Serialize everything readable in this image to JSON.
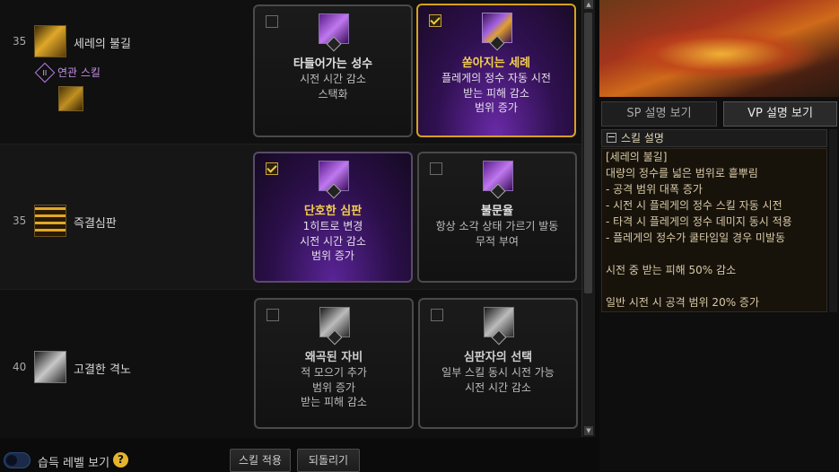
{
  "rows": [
    {
      "level": "35",
      "name": "세레의 불길",
      "related": "연관 스킬",
      "options": [
        {
          "checked": false,
          "roman": "I",
          "title": "타들어가는 성수",
          "desc": [
            "시전 시간 감소",
            "스택화"
          ]
        },
        {
          "checked": true,
          "roman": "II",
          "title": "쏟아지는 세례",
          "desc": [
            "플레게의 정수 자동 시전",
            "받는 피해 감소",
            "범위 증가"
          ]
        }
      ]
    },
    {
      "level": "35",
      "name": "즉결심판",
      "options": [
        {
          "checked": true,
          "roman": "I",
          "title": "단호한 심판",
          "desc": [
            "1히트로 변경",
            "시전 시간 감소",
            "범위 증가"
          ]
        },
        {
          "checked": false,
          "roman": "II",
          "title": "불문율",
          "desc": [
            "항상 소각 상태 가르기 발동",
            "무적 부여"
          ]
        }
      ]
    },
    {
      "level": "40",
      "name": "고결한 격노",
      "options": [
        {
          "checked": false,
          "roman": "I",
          "title": "왜곡된 자비",
          "desc": [
            "적 모으기 추가",
            "범위 증가",
            "받는 피해 감소"
          ]
        },
        {
          "checked": false,
          "roman": "II",
          "title": "심판자의 선택",
          "desc": [
            "일부 스킬 동시 시전 가능",
            "시전 시간 감소"
          ]
        }
      ]
    }
  ],
  "bottom": {
    "toggle_label": "습득 레벨 보기",
    "help": "?",
    "apply": "스킬 적용",
    "revert": "되돌리기"
  },
  "right": {
    "tab_sp": "SP 설명 보기",
    "tab_vp": "VP 설명 보기",
    "section_title": "스킬 설명",
    "desc_lines": [
      "[세레의 불길]",
      "대량의 정수를 넓은 범위로 흩뿌림",
      "  - 공격 범위 대폭 증가",
      "  - 시전 시 플레게의 정수 스킬 자동 시전",
      "  - 타격 시 플레게의 정수 데미지 동시 적용",
      "  - 플레게의 정수가 쿨타임일 경우 미발동",
      "",
      "시전 중 받는 피해 50% 감소",
      "",
      "일반 시전 시 공격 범위 20% 증가"
    ]
  }
}
